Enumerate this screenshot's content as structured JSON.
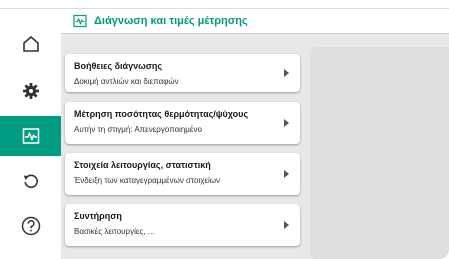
{
  "colors": {
    "accent": "#009c82",
    "content_bg": "#e8e8e8",
    "panel_bg": "#dedede"
  },
  "header": {
    "title": "Διάγνωση και τιμές μέτρησης",
    "icon": "diagnostics-pulse-icon"
  },
  "sidebar": {
    "items": [
      {
        "name": "home",
        "icon": "home-icon",
        "active": false
      },
      {
        "name": "settings",
        "icon": "gear-icon",
        "active": false
      },
      {
        "name": "diagnostics",
        "icon": "diagnostics-pulse-icon",
        "active": true
      },
      {
        "name": "restore",
        "icon": "undo-icon",
        "active": false
      },
      {
        "name": "help",
        "icon": "help-icon",
        "active": false
      }
    ]
  },
  "menu": [
    {
      "title": "Βοήθειες διάγνωσης",
      "subtitle": "Δοκιμή αντλιών και διεπαφών"
    },
    {
      "title": "Μέτρηση ποσότητας θερμότητας/ψύχους",
      "subtitle": "Αυτήν τη στιγμή: Απενεργοποιημένο"
    },
    {
      "title": "Στοιχεία λειτουργίας, στατιστική",
      "subtitle": "Ένδειξη των καταγεγραμμένων στοιχείων"
    },
    {
      "title": "Συντήρηση",
      "subtitle": "Βασικές λειτουργίες, ..."
    }
  ]
}
